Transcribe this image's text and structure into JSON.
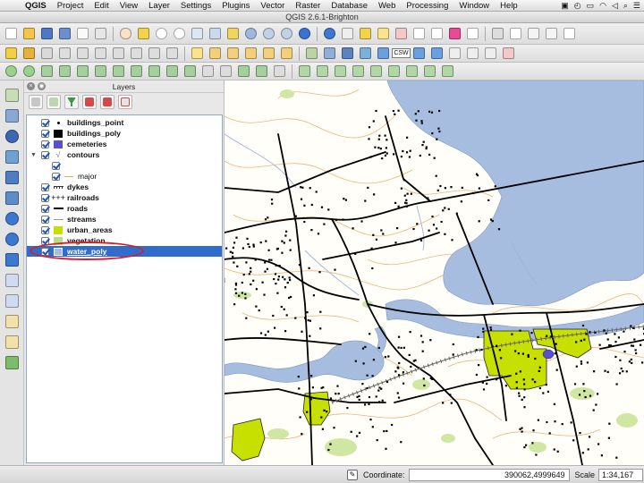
{
  "menubar": {
    "apple": "",
    "items": [
      "QGIS",
      "Project",
      "Edit",
      "View",
      "Layer",
      "Settings",
      "Plugins",
      "Vector",
      "Raster",
      "Database",
      "Web",
      "Processing",
      "Window",
      "Help"
    ]
  },
  "window": {
    "title": "QGIS 2.6.1-Brighton"
  },
  "toolbar": {
    "csw_label": "CSW"
  },
  "layers_panel": {
    "title": "Layers",
    "close_glyph": "×",
    "float_glyph": "◉",
    "layers": [
      {
        "name": "buildings_point",
        "symbol": "point",
        "checked": true
      },
      {
        "name": "buildings_poly",
        "symbol": "black-square",
        "checked": true
      },
      {
        "name": "cemeteries",
        "symbol": "purple-square",
        "checked": true
      },
      {
        "name": "contours",
        "symbol": "expand",
        "checked": true
      },
      {
        "name": "",
        "symbol": "none",
        "checked": true
      },
      {
        "name": "major",
        "symbol": "orange-line",
        "checked": true
      },
      {
        "name": "dykes",
        "symbol": "dyke-line",
        "checked": true
      },
      {
        "name": "railroads",
        "symbol": "rail-line",
        "checked": true
      },
      {
        "name": "roads",
        "symbol": "black-line",
        "checked": true
      },
      {
        "name": "streams",
        "symbol": "grey-line",
        "checked": true
      },
      {
        "name": "urban_areas",
        "symbol": "lime-square",
        "checked": true
      },
      {
        "name": "vegetation",
        "symbol": "green-square",
        "checked": true
      },
      {
        "name": "water_poly",
        "symbol": "blue-square",
        "checked": true,
        "selected": true
      }
    ]
  },
  "statusbar": {
    "coordinate_label": "Coordinate:",
    "coordinate_value": "390062,4999649",
    "scale_label": "Scale",
    "scale_value": "1:34,167"
  },
  "colors": {
    "water": "#a7bde0",
    "urban": "#c8e000",
    "vegetation": "#cfe7a2",
    "contours": "#f2b37a",
    "streams": "#9fb6d8",
    "selection": "#2f6ccb",
    "highlight": "#d81e27"
  }
}
